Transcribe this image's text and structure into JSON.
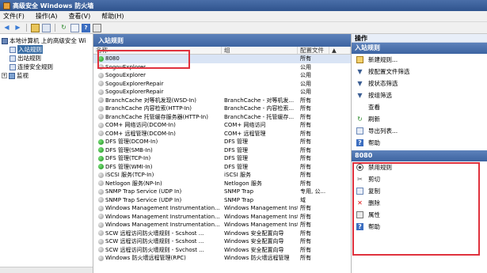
{
  "window": {
    "title": "高级安全 Windows 防火墙"
  },
  "menu": [
    "文件(F)",
    "操作(A)",
    "查看(V)",
    "帮助(H)"
  ],
  "toolbar": {
    "buttons": [
      "back-icon",
      "forward-icon",
      "up-icon",
      "show-hide-tree-icon",
      "refresh-icon",
      "export-icon",
      "help-icon",
      "properties-icon"
    ]
  },
  "tree": {
    "root": "本地计算机 上的高级安全 Wi",
    "items": [
      {
        "label": "入站规则",
        "selected": true
      },
      {
        "label": "出站规则",
        "selected": false
      },
      {
        "label": "连接安全规则",
        "selected": false
      },
      {
        "label": "监视",
        "selected": false
      }
    ]
  },
  "center": {
    "header": "入站规则",
    "columns": [
      "名称",
      "组",
      "配置文件",
      "▲"
    ],
    "rows": [
      {
        "name": "8080",
        "group": "",
        "profile": "所有",
        "enabled": true,
        "selected": true
      },
      {
        "name": "SogouExplorer",
        "group": "",
        "profile": "公用",
        "enabled": false
      },
      {
        "name": "SogouExplorer",
        "group": "",
        "profile": "公用",
        "enabled": false
      },
      {
        "name": "SogouExplorerRepair",
        "group": "",
        "profile": "公用",
        "enabled": false
      },
      {
        "name": "SogouExplorerRepair",
        "group": "",
        "profile": "公用",
        "enabled": false
      },
      {
        "name": "BranchCache 对等机发现(WSD-In)",
        "group": "BranchCache - 对等机发...",
        "profile": "所有",
        "enabled": false
      },
      {
        "name": "BranchCache 内容检索(HTTP-In)",
        "group": "BranchCache - 内容检索...",
        "profile": "所有",
        "enabled": false
      },
      {
        "name": "BranchCache 托管缓存服务器(HTTP-In)",
        "group": "BranchCache - 托管缓存...",
        "profile": "所有",
        "enabled": false
      },
      {
        "name": "COM+ 网络访问(DCOM-In)",
        "group": "COM+ 网络访问",
        "profile": "所有",
        "enabled": false
      },
      {
        "name": "COM+ 远程管理(DCOM-In)",
        "group": "COM+ 远程管理",
        "profile": "所有",
        "enabled": false
      },
      {
        "name": "DFS 管理(DCOM-In)",
        "group": "DFS 管理",
        "profile": "所有",
        "enabled": true
      },
      {
        "name": "DFS 管理(SMB-In)",
        "group": "DFS 管理",
        "profile": "所有",
        "enabled": true
      },
      {
        "name": "DFS 管理(TCP-In)",
        "group": "DFS 管理",
        "profile": "所有",
        "enabled": true
      },
      {
        "name": "DFS 管理(WMI-In)",
        "group": "DFS 管理",
        "profile": "所有",
        "enabled": true
      },
      {
        "name": "iSCSI 服务(TCP-In)",
        "group": "iSCSI 服务",
        "profile": "所有",
        "enabled": false
      },
      {
        "name": "Netlogon 服务(NP-In)",
        "group": "Netlogon 服务",
        "profile": "所有",
        "enabled": false
      },
      {
        "name": "SNMP Trap Service (UDP In)",
        "group": "SNMP Trap",
        "profile": "专用, 公...",
        "enabled": false
      },
      {
        "name": "SNMP Trap Service (UDP In)",
        "group": "SNMP Trap",
        "profile": "域",
        "enabled": false
      },
      {
        "name": "Windows Management Instrumentation...",
        "group": "Windows Management Inst...",
        "profile": "所有",
        "enabled": false
      },
      {
        "name": "Windows Management Instrumentation...",
        "group": "Windows Management Inst...",
        "profile": "所有",
        "enabled": false
      },
      {
        "name": "Windows Management Instrumentation...",
        "group": "Windows Management Inst...",
        "profile": "所有",
        "enabled": false
      },
      {
        "name": "SCW 远程访问防火墙规则 - Scshost ...",
        "group": "Windows 安全配置向导",
        "profile": "所有",
        "enabled": false
      },
      {
        "name": "SCW 远程访问防火墙规则 - Scshost ...",
        "group": "Windows 安全配置向导",
        "profile": "所有",
        "enabled": false
      },
      {
        "name": "SCW 远程访问防火墙规则 - Svchost ...",
        "group": "Windows 安全配置向导",
        "profile": "所有",
        "enabled": false
      },
      {
        "name": "Windows 防火墙远程管理(RPC)",
        "group": "Windows 防火墙远程管理",
        "profile": "所有",
        "enabled": false
      }
    ]
  },
  "actions": {
    "title": "操作",
    "section1": {
      "header": "入站规则",
      "items": [
        {
          "label": "新建规则...",
          "icon": "new-rule-icon"
        },
        {
          "label": "按配置文件筛选",
          "icon": "filter-icon"
        },
        {
          "label": "按状态筛选",
          "icon": "filter-icon"
        },
        {
          "label": "按组筛选",
          "icon": "filter-icon"
        },
        {
          "label": "查看",
          "icon": "view-icon"
        },
        {
          "label": "刷新",
          "icon": "refresh-icon"
        },
        {
          "label": "导出列表...",
          "icon": "export-icon"
        },
        {
          "label": "帮助",
          "icon": "help-icon"
        }
      ]
    },
    "section2": {
      "header": "8080",
      "items": [
        {
          "label": "禁用规则",
          "icon": "disable-icon"
        },
        {
          "label": "剪切",
          "icon": "cut-icon"
        },
        {
          "label": "复制",
          "icon": "copy-icon"
        },
        {
          "label": "删除",
          "icon": "delete-icon"
        },
        {
          "label": "属性",
          "icon": "properties-icon"
        },
        {
          "label": "帮助",
          "icon": "help-icon"
        }
      ]
    }
  },
  "colors": {
    "title_bar": "#2f548e",
    "section_header": "#3d64a1",
    "highlight_box": "#e0323e",
    "enabled_green": "#1a8f1a"
  }
}
